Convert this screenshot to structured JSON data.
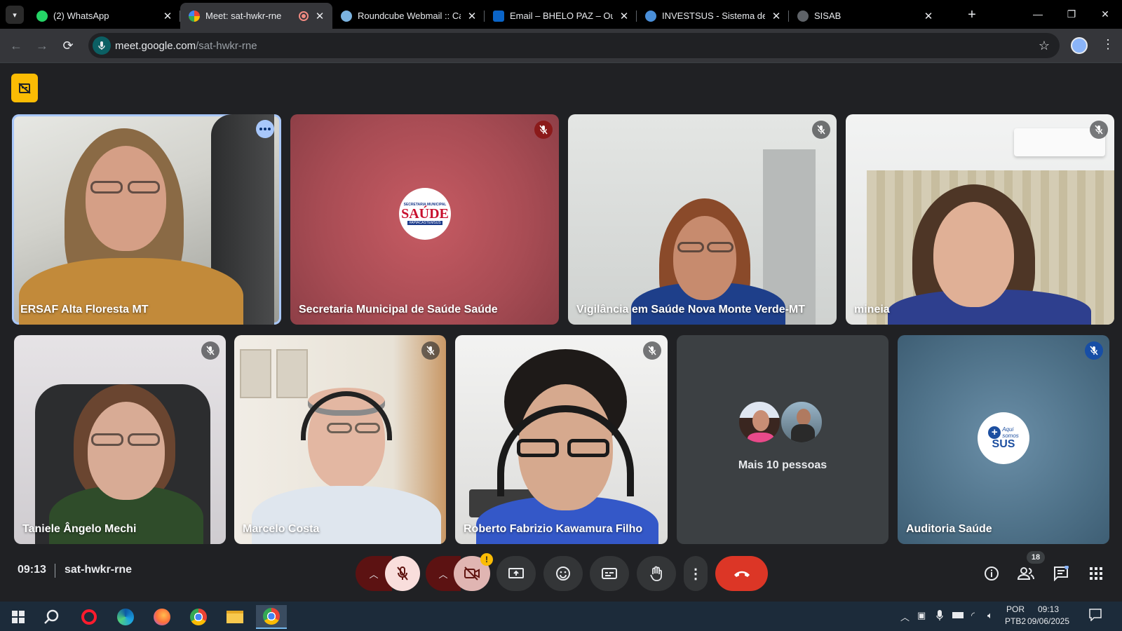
{
  "browser": {
    "tabs": [
      {
        "title": "(2) WhatsApp",
        "favicon_color": "#25d366"
      },
      {
        "title": "Meet: sat-hwkr-rne",
        "favicon_color": "#00ac47",
        "active": true,
        "recording": true
      },
      {
        "title": "Roundcube Webmail :: Cai",
        "favicon_color": "#7bb3e0"
      },
      {
        "title": "Email – BHELO PAZ – Outlo",
        "favicon_color": "#0a64c8"
      },
      {
        "title": "INVESTSUS - Sistema de In",
        "favicon_color": "#4a8fd9"
      },
      {
        "title": "SISAB",
        "favicon_color": "#9aa0a6"
      }
    ],
    "url_host": "meet.google.com",
    "url_path": "/sat-hwkr-rne"
  },
  "meet": {
    "participants": [
      {
        "name": "ERSAF Alta Floresta MT",
        "mic": "options"
      },
      {
        "name": "Secretaria Municipal de Saúde Saúde",
        "mic": "muted-red"
      },
      {
        "name": "Vigilância em Saúde Nova Monte Verde-MT",
        "mic": "muted"
      },
      {
        "name": "mineia",
        "mic": "muted"
      },
      {
        "name": "Taniele Ângelo Mechi",
        "mic": "muted"
      },
      {
        "name": "Marcelo Costa",
        "mic": "muted"
      },
      {
        "name": "Roberto Fabrizio Kawamura Filho",
        "mic": "muted"
      },
      {
        "name": "",
        "mic": "none"
      },
      {
        "name": "Auditoria Saúde",
        "mic": "muted-blue"
      }
    ],
    "others_label": "Mais 10 pessoas",
    "logo_saude": {
      "top": "SECRETARIA MUNICIPAL",
      "main": "SAÚDE",
      "bottom": "#APIACÁSTEMSUS"
    },
    "logo_sus": {
      "line1": "Aqui",
      "line2": "somos",
      "main": "SUS"
    },
    "time": "09:13",
    "meeting_code": "sat-hwkr-rne",
    "participant_count": "18",
    "camera_warning": "!"
  },
  "taskbar": {
    "lang_line1": "POR",
    "lang_line2": "PTB2",
    "time": "09:13",
    "date": "09/06/2025"
  }
}
